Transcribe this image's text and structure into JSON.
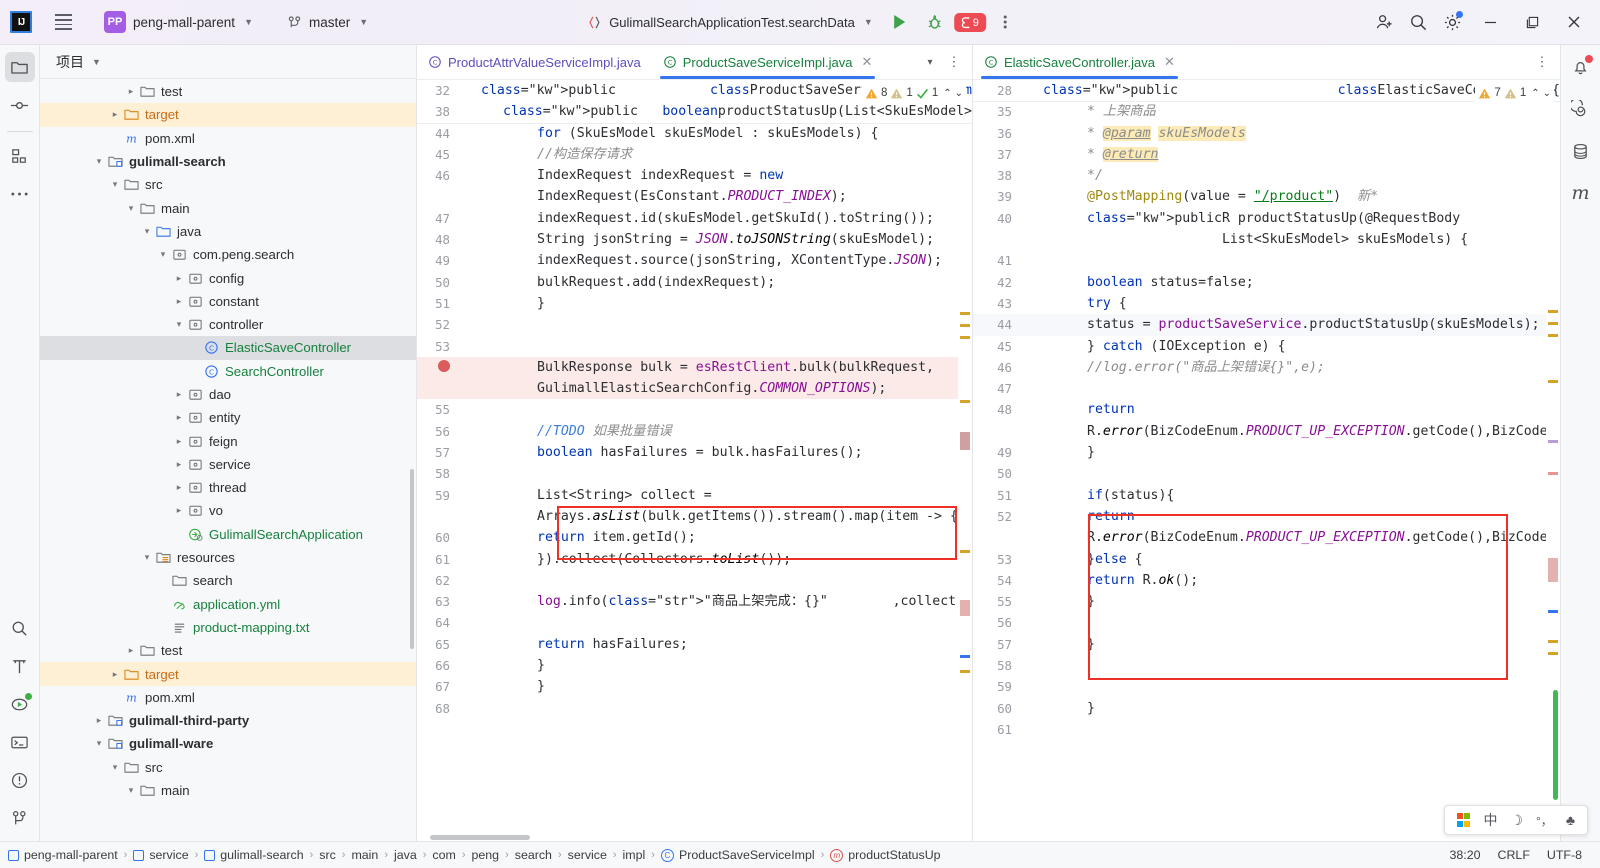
{
  "toolbar": {
    "logo": "IJ",
    "project_name": "peng-mall-parent",
    "branch": "master",
    "run_config": "GulimallSearchApplicationTest.searchData",
    "debug_count": "9",
    "icons": [
      "hamburger-menu-icon",
      "project-chip-icon",
      "branch-icon",
      "run-icon",
      "debug-icon",
      "stop-icon",
      "more-icon",
      "account-icon",
      "search-icon",
      "settings-icon",
      "minimize-icon",
      "maximize-icon",
      "close-icon"
    ]
  },
  "left_stripe": {
    "items": [
      {
        "name": "project-tool-icon",
        "glyph": "folder",
        "active": true
      },
      {
        "name": "commit-tool-icon",
        "glyph": "commit",
        "active": false
      },
      {
        "name": "structure-tool-icon",
        "glyph": "structure",
        "active": false
      },
      {
        "name": "more-tool-icon",
        "glyph": "dots",
        "active": false
      }
    ],
    "bottom": [
      {
        "name": "find-tool-icon",
        "glyph": "search"
      },
      {
        "name": "build-tool-icon",
        "glyph": "hammer"
      },
      {
        "name": "run-tool-icon",
        "glyph": "runpanel"
      },
      {
        "name": "terminal-tool-icon",
        "glyph": "terminal"
      },
      {
        "name": "problems-tool-icon",
        "glyph": "problems"
      },
      {
        "name": "git-tool-icon",
        "glyph": "git"
      }
    ]
  },
  "project_panel": {
    "title": "项目",
    "tree": [
      {
        "depth": 5,
        "arrow": "right",
        "icon": "folder",
        "label": "test",
        "style": ""
      },
      {
        "depth": 4,
        "arrow": "right",
        "icon": "folder-orange",
        "label": "target",
        "style": "orange",
        "row": "hl"
      },
      {
        "depth": 4,
        "arrow": "none",
        "icon": "maven-m",
        "label": "pom.xml",
        "style": ""
      },
      {
        "depth": 3,
        "arrow": "down",
        "icon": "module",
        "label": "gulimall-search",
        "style": "bold"
      },
      {
        "depth": 4,
        "arrow": "down",
        "icon": "folder",
        "label": "src",
        "style": ""
      },
      {
        "depth": 5,
        "arrow": "down",
        "icon": "folder",
        "label": "main",
        "style": ""
      },
      {
        "depth": 6,
        "arrow": "down",
        "icon": "folder-src",
        "label": "java",
        "style": ""
      },
      {
        "depth": 7,
        "arrow": "down",
        "icon": "package",
        "label": "com.peng.search",
        "style": ""
      },
      {
        "depth": 8,
        "arrow": "right",
        "icon": "package",
        "label": "config",
        "style": ""
      },
      {
        "depth": 8,
        "arrow": "right",
        "icon": "package",
        "label": "constant",
        "style": ""
      },
      {
        "depth": 8,
        "arrow": "down",
        "icon": "package",
        "label": "controller",
        "style": ""
      },
      {
        "depth": 9,
        "arrow": "none",
        "icon": "class",
        "label": "ElasticSaveController",
        "style": "green",
        "row": "selrow"
      },
      {
        "depth": 9,
        "arrow": "none",
        "icon": "class",
        "label": "SearchController",
        "style": "green"
      },
      {
        "depth": 8,
        "arrow": "right",
        "icon": "package",
        "label": "dao",
        "style": ""
      },
      {
        "depth": 8,
        "arrow": "right",
        "icon": "package",
        "label": "entity",
        "style": ""
      },
      {
        "depth": 8,
        "arrow": "right",
        "icon": "package",
        "label": "feign",
        "style": ""
      },
      {
        "depth": 8,
        "arrow": "right",
        "icon": "package",
        "label": "service",
        "style": ""
      },
      {
        "depth": 8,
        "arrow": "right",
        "icon": "package",
        "label": "thread",
        "style": ""
      },
      {
        "depth": 8,
        "arrow": "right",
        "icon": "package",
        "label": "vo",
        "style": ""
      },
      {
        "depth": 8,
        "arrow": "none",
        "icon": "spring-class",
        "label": "GulimallSearchApplication",
        "style": "green"
      },
      {
        "depth": 6,
        "arrow": "down",
        "icon": "folder-res",
        "label": "resources",
        "style": ""
      },
      {
        "depth": 7,
        "arrow": "none",
        "icon": "folder",
        "label": "search",
        "style": ""
      },
      {
        "depth": 7,
        "arrow": "none",
        "icon": "yml",
        "label": "application.yml",
        "style": "green"
      },
      {
        "depth": 7,
        "arrow": "none",
        "icon": "txt",
        "label": "product-mapping.txt",
        "style": "green"
      },
      {
        "depth": 5,
        "arrow": "right",
        "icon": "folder",
        "label": "test",
        "style": ""
      },
      {
        "depth": 4,
        "arrow": "right",
        "icon": "folder-orange",
        "label": "target",
        "style": "orange",
        "row": "hl"
      },
      {
        "depth": 4,
        "arrow": "none",
        "icon": "maven-m",
        "label": "pom.xml",
        "style": ""
      },
      {
        "depth": 3,
        "arrow": "right",
        "icon": "module",
        "label": "gulimall-third-party",
        "style": "bold"
      },
      {
        "depth": 3,
        "arrow": "down",
        "icon": "module",
        "label": "gulimall-ware",
        "style": "bold"
      },
      {
        "depth": 4,
        "arrow": "down",
        "icon": "folder",
        "label": "src",
        "style": ""
      },
      {
        "depth": 5,
        "arrow": "down",
        "icon": "folder",
        "label": "main",
        "style": ""
      }
    ]
  },
  "editor_left": {
    "tabs": [
      {
        "label": "ProductAttrValueServiceImpl.java",
        "active": false,
        "closable": false
      },
      {
        "label": "ProductSaveServiceImpl.java",
        "active": true,
        "closable": true
      }
    ],
    "inspection": {
      "warnings": "8",
      "weak_warnings": "1",
      "ok": "1"
    },
    "sticky": [
      {
        "num": "32",
        "text": "public class ProductSaveServiceImpl implem"
      },
      {
        "num": "38",
        "text": "public boolean productStatusUp(List<SkuEsModel>"
      }
    ],
    "lines": [
      {
        "num": "44",
        "text": "for (SkuEsModel skuEsModel : skuEsModels) {"
      },
      {
        "num": "45",
        "text": "//构造保存请求"
      },
      {
        "num": "46",
        "text": "IndexRequest indexRequest = new IndexRequest(EsConstant.PRODUCT_INDEX);"
      },
      {
        "num": "47",
        "text": "indexRequest.id(skuEsModel.getSkuId().toString());"
      },
      {
        "num": "48",
        "text": "String jsonString = JSON.toJSONString(skuEsModel);"
      },
      {
        "num": "49",
        "text": "indexRequest.source(jsonString, XContentType.JSON);"
      },
      {
        "num": "50",
        "text": "bulkRequest.add(indexRequest);"
      },
      {
        "num": "51",
        "text": "}"
      },
      {
        "num": "52",
        "text": ""
      },
      {
        "num": "53",
        "text": ""
      },
      {
        "num": "54",
        "text": "BulkResponse bulk = esRestClient.bulk(bulkRequest, GulimallElasticSearchConfig.COMMON_OPTIONS);",
        "breakpoint": true
      },
      {
        "num": "55",
        "text": ""
      },
      {
        "num": "56",
        "text": "//TODO 如果批量错误"
      },
      {
        "num": "57",
        "text": "boolean hasFailures = bulk.hasFailures();"
      },
      {
        "num": "58",
        "text": ""
      },
      {
        "num": "59",
        "text": "List<String> collect = Arrays.asList(bulk.getItems()).stream().map(item -> {"
      },
      {
        "num": "60",
        "text": "return item.getId();"
      },
      {
        "num": "61",
        "text": "}).collect(Collectors.toList());"
      },
      {
        "num": "62",
        "text": ""
      },
      {
        "num": "63",
        "text": "log.info(\"商品上架完成：{}\",collect);"
      },
      {
        "num": "64",
        "text": ""
      },
      {
        "num": "65",
        "text": "return hasFailures;"
      },
      {
        "num": "66",
        "text": "}"
      },
      {
        "num": "67",
        "text": "}"
      },
      {
        "num": "68",
        "text": ""
      }
    ]
  },
  "editor_right": {
    "tabs": [
      {
        "label": "ElasticSaveController.java",
        "active": true,
        "closable": true
      }
    ],
    "inspection": {
      "warnings": "7",
      "weak_warnings": "1"
    },
    "sticky": [
      {
        "num": "28",
        "text": "public class ElasticSaveController {"
      }
    ],
    "lines": [
      {
        "num": "35",
        "text": "* 上架商品"
      },
      {
        "num": "36",
        "text": "* @param skuEsModels"
      },
      {
        "num": "37",
        "text": "* @return"
      },
      {
        "num": "38",
        "text": "*/"
      },
      {
        "num": "39",
        "text": "@PostMapping(value = \"/product\")  新*"
      },
      {
        "num": "40",
        "text": "public R productStatusUp(@RequestBody List<SkuEsModel> skuEsModels) {"
      },
      {
        "num": "41",
        "text": ""
      },
      {
        "num": "42",
        "text": "boolean status=false;"
      },
      {
        "num": "43",
        "text": "try {"
      },
      {
        "num": "44",
        "text": "status = productSaveService.productStatusUp(skuEsModels);",
        "current": true
      },
      {
        "num": "45",
        "text": "} catch (IOException e) {"
      },
      {
        "num": "46",
        "text": "//log.error(\"商品上架错误{}\",e);"
      },
      {
        "num": "47",
        "text": ""
      },
      {
        "num": "48",
        "text": "return R.error(BizCodeEnum.PRODUCT_UP_EXCEPTION.getCode(),BizCodeEnum.PRODUCT_UP_EXCEPTION.getMsg());"
      },
      {
        "num": "49",
        "text": "}"
      },
      {
        "num": "50",
        "text": ""
      },
      {
        "num": "51",
        "text": "if(status){"
      },
      {
        "num": "52",
        "text": "return R.error(BizCodeEnum.PRODUCT_UP_EXCEPTION.getCode(),BizCodeEnum.PRODUCT_UP_EXCEPTION.getMsg());"
      },
      {
        "num": "53",
        "text": "}else {"
      },
      {
        "num": "54",
        "text": "return R.ok();"
      },
      {
        "num": "55",
        "text": "}"
      },
      {
        "num": "56",
        "text": ""
      },
      {
        "num": "57",
        "text": "}"
      },
      {
        "num": "58",
        "text": ""
      },
      {
        "num": "59",
        "text": ""
      },
      {
        "num": "60",
        "text": "}"
      },
      {
        "num": "61",
        "text": ""
      }
    ]
  },
  "right_stripe": {
    "items": [
      {
        "name": "notifications-icon",
        "glyph": "bell",
        "badge": true
      },
      {
        "name": "spiral-icon",
        "glyph": "spiral"
      },
      {
        "name": "database-icon",
        "glyph": "database"
      },
      {
        "name": "maven-icon",
        "glyph": "m"
      }
    ]
  },
  "status_bar": {
    "breadcrumb": [
      "peng-mall-parent",
      "service",
      "gulimall-search",
      "src",
      "main",
      "java",
      "com",
      "peng",
      "search",
      "service",
      "impl",
      "ProductSaveServiceImpl",
      "productStatusUp"
    ],
    "caret": "38:20",
    "line_sep": "CRLF",
    "encoding": "UTF-8"
  },
  "ime": {
    "mode": "中",
    "icons": [
      "ms-logo-icon",
      "chinese-mode-icon",
      "moon-icon",
      "punctuation-icon",
      "toolbox-icon"
    ]
  }
}
